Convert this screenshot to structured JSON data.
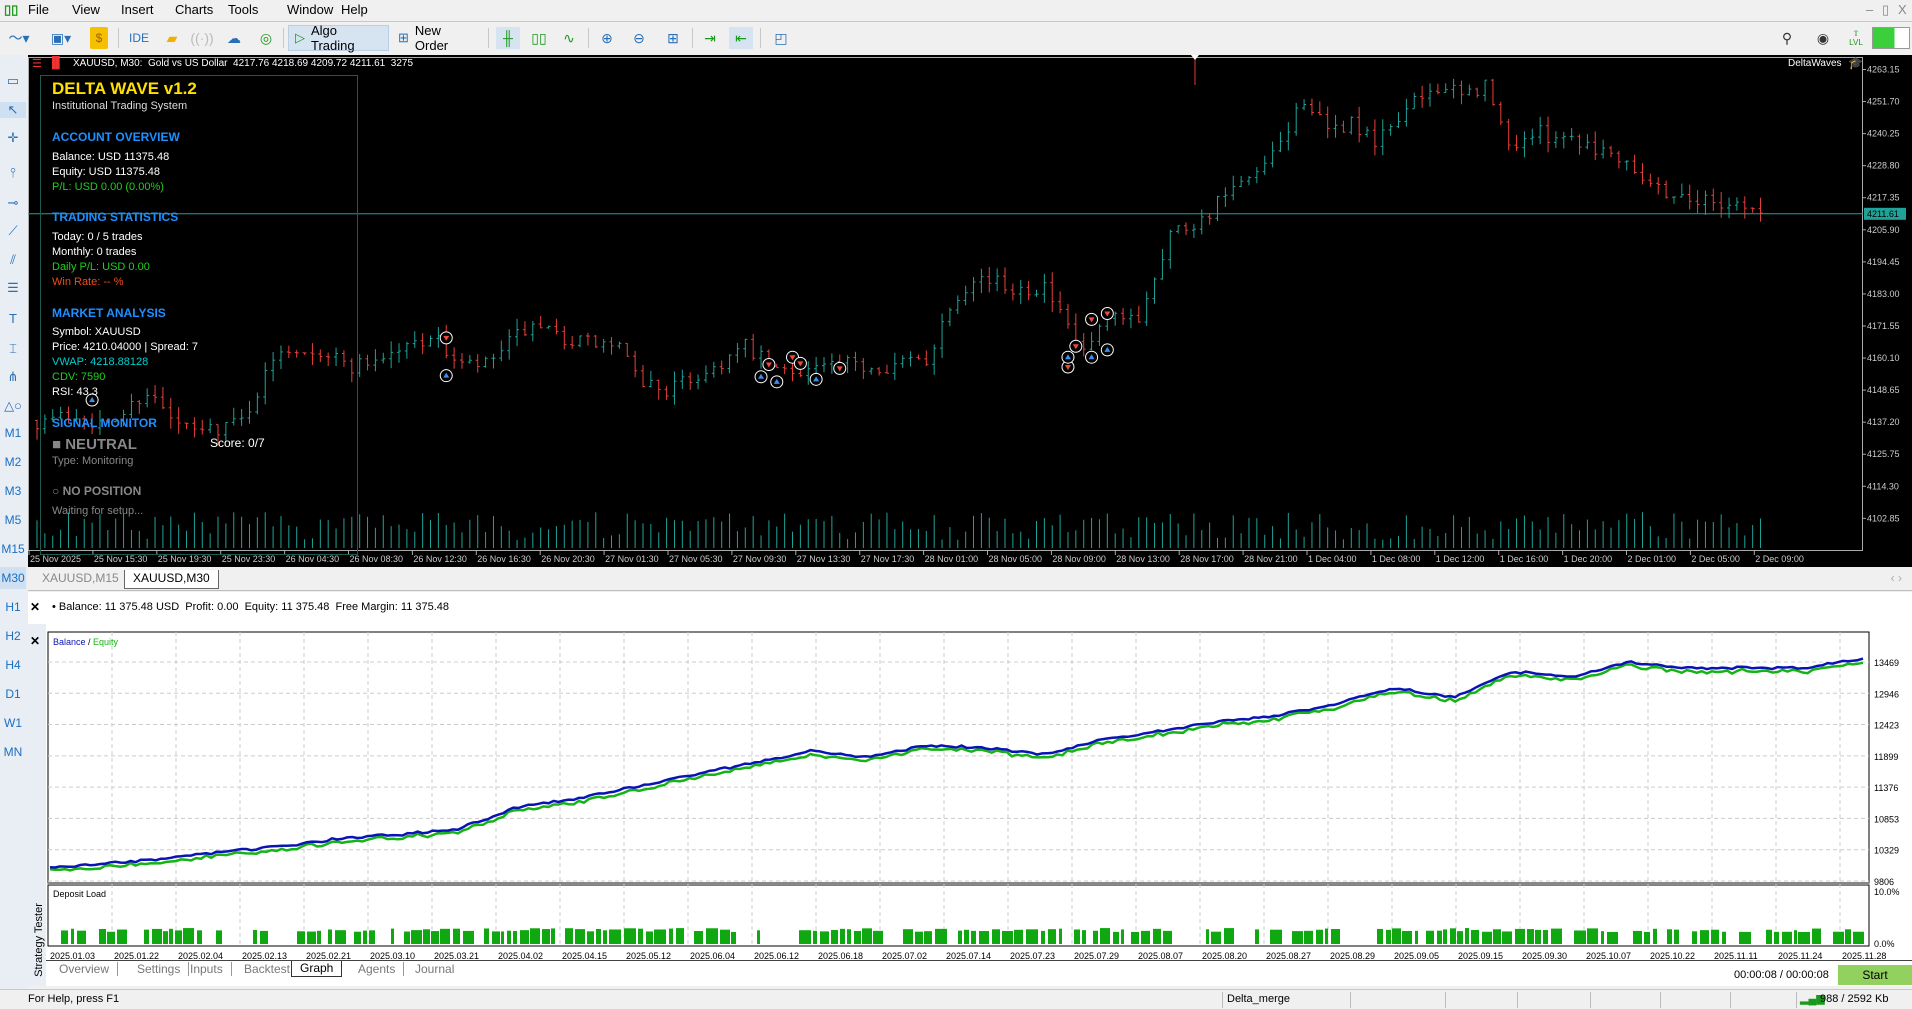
{
  "menu": [
    "File",
    "View",
    "Insert",
    "Charts",
    "Tools",
    "Window",
    "Help"
  ],
  "toolbar": {
    "ide": "IDE",
    "algo_trading": "Algo Trading",
    "new_order": "New Order",
    "lvl": "LVL"
  },
  "window_controls": {
    "minimize": "–",
    "restore": "▯",
    "close": "X"
  },
  "left_tools": [
    "rectangle-icon",
    "cursor-icon",
    "crosshair-icon",
    "vertical-line-icon",
    "horizontal-line-icon",
    "trendline-icon",
    "channel-icon",
    "fibonacci-icon",
    "text-icon",
    "text-label-icon",
    "pitchfork-icon",
    "shapes-icon"
  ],
  "timeframes": [
    "M1",
    "M2",
    "M3",
    "M5",
    "M15",
    "M30",
    "H1",
    "H2",
    "H4",
    "D1",
    "W1",
    "MN"
  ],
  "active_timeframe": "M30",
  "chart": {
    "header": "XAUUSD, M30:  Gold vs US Dollar  4217.76 4218.69 4209.72 4211.61  3275",
    "indicator_label": "DeltaWaves",
    "current_price": "4211.61",
    "price_ticks": [
      "4263.15",
      "4251.70",
      "4240.25",
      "4228.80",
      "4217.35",
      "4205.90",
      "4194.45",
      "4183.00",
      "4171.55",
      "4160.10",
      "4148.65",
      "4137.20",
      "4125.75",
      "4114.30",
      "4102.85"
    ],
    "time_labels": [
      "25 Nov 2025",
      "25 Nov 15:30",
      "25 Nov 19:30",
      "25 Nov 23:30",
      "26 Nov 04:30",
      "26 Nov 08:30",
      "26 Nov 12:30",
      "26 Nov 16:30",
      "26 Nov 20:30",
      "27 Nov 01:30",
      "27 Nov 05:30",
      "27 Nov 09:30",
      "27 Nov 13:30",
      "27 Nov 17:30",
      "28 Nov 01:00",
      "28 Nov 05:00",
      "28 Nov 09:00",
      "28 Nov 13:00",
      "28 Nov 17:00",
      "28 Nov 21:00",
      "1 Dec 04:00",
      "1 Dec 08:00",
      "1 Dec 12:00",
      "1 Dec 16:00",
      "1 Dec 20:00",
      "2 Dec 01:00",
      "2 Dec 05:00",
      "2 Dec 09:00"
    ],
    "bull_color": "#1fa398",
    "bear_color": "#e8403a",
    "bars": 220,
    "price_path": [
      [
        0,
        4137.8
      ],
      [
        5,
        4139.9
      ],
      [
        9,
        4135.5
      ],
      [
        14,
        4148.6
      ],
      [
        17,
        4137.8
      ],
      [
        20,
        4133.4
      ],
      [
        26,
        4137.8
      ],
      [
        31,
        4163.9
      ],
      [
        35,
        4163.9
      ],
      [
        40,
        4157.3
      ],
      [
        45,
        4161.7
      ],
      [
        50,
        4168.2
      ],
      [
        54,
        4157.3
      ],
      [
        57,
        4157.3
      ],
      [
        62,
        4170.4
      ],
      [
        69,
        4166.0
      ],
      [
        74,
        4163.9
      ],
      [
        76,
        4153.0
      ],
      [
        80,
        4148.6
      ],
      [
        85,
        4155.1
      ],
      [
        90,
        4163.9
      ],
      [
        94,
        4155.1
      ],
      [
        100,
        4157.3
      ],
      [
        107,
        4157.3
      ],
      [
        113,
        4159.5
      ],
      [
        116,
        4179.1
      ],
      [
        119,
        4190.0
      ],
      [
        123,
        4185.6
      ],
      [
        128,
        4185.6
      ],
      [
        130,
        4174.8
      ],
      [
        133,
        4161.7
      ],
      [
        136,
        4172.6
      ],
      [
        140,
        4174.8
      ],
      [
        144,
        4205.2
      ],
      [
        148,
        4209.6
      ],
      [
        151,
        4218.3
      ],
      [
        154,
        4222.7
      ],
      [
        157,
        4231.4
      ],
      [
        161,
        4253.1
      ],
      [
        164,
        4240.1
      ],
      [
        167,
        4244.4
      ],
      [
        170,
        4235.7
      ],
      [
        173,
        4246.6
      ],
      [
        178,
        4257.5
      ],
      [
        181,
        4253.1
      ],
      [
        184,
        4257.5
      ],
      [
        187,
        4235.7
      ],
      [
        190,
        4240.1
      ],
      [
        194,
        4240.1
      ],
      [
        198,
        4235.7
      ],
      [
        202,
        4231.4
      ],
      [
        205,
        4222.7
      ],
      [
        208,
        4218.3
      ],
      [
        213,
        4216.0
      ],
      [
        216,
        4216.0
      ],
      [
        219,
        4211.6
      ]
    ],
    "signals": [
      [
        7,
        4145.1,
        "buy"
      ],
      [
        52,
        4167.3,
        "sell"
      ],
      [
        52,
        4153.8,
        "buy"
      ],
      [
        92,
        4153.4,
        "buy"
      ],
      [
        93,
        4157.8,
        "sell"
      ],
      [
        94,
        4151.6,
        "buy"
      ],
      [
        96,
        4160.4,
        "sell"
      ],
      [
        97,
        4158.2,
        "sell"
      ],
      [
        99,
        4152.5,
        "buy"
      ],
      [
        102,
        4156.4,
        "sell"
      ],
      [
        131,
        4156.9,
        "sell"
      ],
      [
        131,
        4160.4,
        "buy"
      ],
      [
        132,
        4164.3,
        "sell"
      ],
      [
        134,
        4160.4,
        "buy"
      ],
      [
        134,
        4173.9,
        "sell"
      ],
      [
        136,
        4176.0,
        "sell"
      ],
      [
        136,
        4163.0,
        "buy"
      ]
    ]
  },
  "panel": {
    "title": "DELTA WAVE v1.2",
    "subtitle": "Institutional Trading System",
    "account_header": "ACCOUNT OVERVIEW",
    "balance": "Balance: USD 11375.48",
    "equity": "Equity: USD 11375.48",
    "pl": "P/L: USD 0.00 (0.00%)",
    "stats_header": "TRADING STATISTICS",
    "today": "Today: 0 / 5 trades",
    "monthly": "Monthly: 0 trades",
    "daily_pl": "Daily P/L: USD 0.00",
    "win_rate": "Win Rate: -- %",
    "market_header": "MARKET ANALYSIS",
    "symbol": "Symbol: XAUUSD",
    "price": "Price: 4210.04000 | Spread: 7",
    "vwap": "VWAP: 4218.88128",
    "cdv": "CDV: 7590",
    "rsi": "RSI: 43.3",
    "signal_header": "SIGNAL MONITOR",
    "signal": "■ NEUTRAL",
    "score": "Score: 0/7",
    "type": "Type: Monitoring",
    "position": "○ NO POSITION",
    "waiting": "Waiting for setup..."
  },
  "chart_tabs": [
    "XAUUSD,M15",
    "XAUUSD,M30"
  ],
  "toolbox": {
    "summary": "• Balance: 11 375.48 USD  Profit: 0.00  Equity: 11 375.48  Free Margin: 11 375.48"
  },
  "tester": {
    "side_label": "Strategy Tester",
    "legend_balance": "Balance",
    "legend_sep": " / ",
    "legend_equity": "Equity",
    "balance_color": "#0a14b4",
    "equity_color": "#16b316",
    "y_ticks": [
      "13469",
      "12946",
      "12423",
      "11899",
      "11376",
      "10853",
      "10329",
      "9806"
    ],
    "y_range": [
      9806,
      13469
    ],
    "equity_path": [
      10028,
      10100,
      10186,
      10300,
      10385,
      10525,
      10584,
      10684,
      11043,
      11181,
      11380,
      11580,
      11779,
      11978,
      11878,
      12077,
      12038,
      11917,
      12177,
      12316,
      12475,
      12575,
      12773,
      13032,
      12873,
      13312,
      13212,
      13469,
      13370,
      13370,
      13370,
      13530
    ],
    "deposit_label": "Deposit Load",
    "deposit_ticks": [
      "10.0%",
      "0.0%"
    ],
    "dates": [
      "2025.01.03",
      "2025.01.22",
      "2025.02.04",
      "2025.02.13",
      "2025.02.21",
      "2025.03.10",
      "2025.03.21",
      "2025.04.02",
      "2025.04.15",
      "2025.05.12",
      "2025.06.04",
      "2025.06.12",
      "2025.06.18",
      "2025.07.02",
      "2025.07.14",
      "2025.07.23",
      "2025.07.29",
      "2025.08.07",
      "2025.08.20",
      "2025.08.27",
      "2025.08.29",
      "2025.09.05",
      "2025.09.15",
      "2025.09.30",
      "2025.10.07",
      "2025.10.22",
      "2025.11.11",
      "2025.11.24",
      "2025.11.28"
    ],
    "tabs": [
      "Overview",
      "Settings",
      "Inputs",
      "Backtest",
      "Graph",
      "Agents",
      "Journal"
    ],
    "active_tab": "Graph",
    "timer": "00:00:08 / 00:00:08",
    "start": "Start"
  },
  "status": {
    "help": "For Help, press F1",
    "profile": "Delta_merge",
    "traffic": "988 / 2592 Kb"
  }
}
